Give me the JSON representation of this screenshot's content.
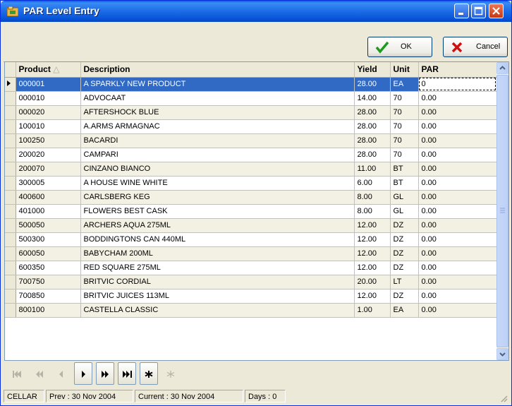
{
  "window": {
    "title": "PAR Level Entry"
  },
  "toolbar": {
    "ok_label": "OK",
    "cancel_label": "Cancel",
    "ok_icon": "checkmark-icon",
    "cancel_icon": "x-icon"
  },
  "grid": {
    "columns": [
      "Product",
      "Description",
      "Yield",
      "Unit",
      "PAR"
    ],
    "current_row_index": 0,
    "rows": [
      {
        "product": "000001",
        "description": "A SPARKLY NEW PRODUCT",
        "yield": "28.00",
        "unit": "EA",
        "par": "0"
      },
      {
        "product": "000010",
        "description": "ADVOCAAT",
        "yield": "14.00",
        "unit": "70",
        "par": "0.00"
      },
      {
        "product": "000020",
        "description": "AFTERSHOCK BLUE",
        "yield": "28.00",
        "unit": "70",
        "par": "0.00"
      },
      {
        "product": "100010",
        "description": "A.ARMS ARMAGNAC",
        "yield": "28.00",
        "unit": "70",
        "par": "0.00"
      },
      {
        "product": "100250",
        "description": "BACARDI",
        "yield": "28.00",
        "unit": "70",
        "par": "0.00"
      },
      {
        "product": "200020",
        "description": "CAMPARI",
        "yield": "28.00",
        "unit": "70",
        "par": "0.00"
      },
      {
        "product": "200070",
        "description": "CINZANO BIANCO",
        "yield": "11.00",
        "unit": "BT",
        "par": "0.00"
      },
      {
        "product": "300005",
        "description": "A HOUSE WINE WHITE",
        "yield": "6.00",
        "unit": "BT",
        "par": "0.00"
      },
      {
        "product": "400600",
        "description": "CARLSBERG KEG",
        "yield": "8.00",
        "unit": "GL",
        "par": "0.00"
      },
      {
        "product": "401000",
        "description": "FLOWERS BEST CASK",
        "yield": "8.00",
        "unit": "GL",
        "par": "0.00"
      },
      {
        "product": "500050",
        "description": "ARCHERS AQUA 275ML",
        "yield": "12.00",
        "unit": "DZ",
        "par": "0.00"
      },
      {
        "product": "500300",
        "description": "BODDINGTONS CAN 440ML",
        "yield": "12.00",
        "unit": "DZ",
        "par": "0.00"
      },
      {
        "product": "600050",
        "description": "BABYCHAM 200ML",
        "yield": "12.00",
        "unit": "DZ",
        "par": "0.00"
      },
      {
        "product": "600350",
        "description": "RED SQUARE 275ML",
        "yield": "12.00",
        "unit": "DZ",
        "par": "0.00"
      },
      {
        "product": "700750",
        "description": "BRITVIC CORDIAL",
        "yield": "20.00",
        "unit": "LT",
        "par": "0.00"
      },
      {
        "product": "700850",
        "description": "BRITVIC JUICES 113ML",
        "yield": "12.00",
        "unit": "DZ",
        "par": "0.00"
      },
      {
        "product": "800100",
        "description": "CASTELLA CLASSIC",
        "yield": "1.00",
        "unit": "EA",
        "par": "0.00"
      }
    ]
  },
  "navigator": {
    "buttons": [
      {
        "name": "nav-first-button",
        "icon": "first-icon",
        "enabled": false
      },
      {
        "name": "nav-prior-page-button",
        "icon": "prior-page-icon",
        "enabled": false
      },
      {
        "name": "nav-prior-button",
        "icon": "prior-icon",
        "enabled": false
      },
      {
        "name": "nav-next-button",
        "icon": "next-icon",
        "enabled": true
      },
      {
        "name": "nav-next-page-button",
        "icon": "next-page-icon",
        "enabled": true
      },
      {
        "name": "nav-last-button",
        "icon": "last-icon",
        "enabled": true
      },
      {
        "name": "nav-insert-button",
        "icon": "asterisk-icon",
        "enabled": true
      },
      {
        "name": "nav-delete-button",
        "icon": "delete-icon",
        "enabled": false
      }
    ]
  },
  "status": {
    "location": "CELLAR",
    "prev": "Prev : 30 Nov 2004",
    "current": "Current : 30 Nov 2004",
    "days": "Days : 0"
  },
  "colors": {
    "titlebar": "#0A5BE3",
    "selection": "#316AC5",
    "ok_green": "#1E9A1E",
    "cancel_red": "#D01010"
  }
}
